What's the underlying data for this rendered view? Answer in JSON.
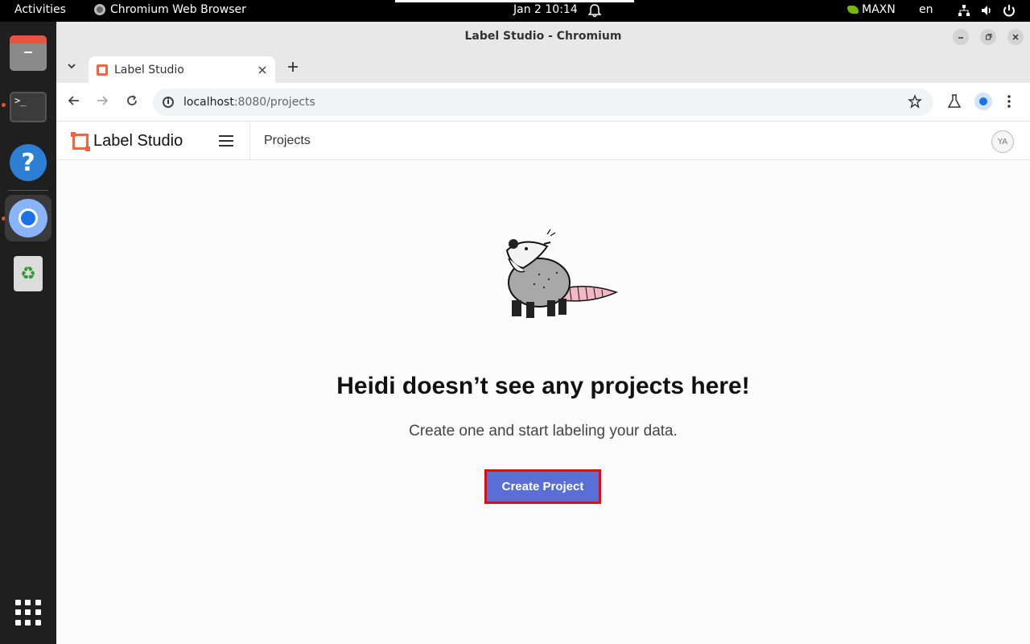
{
  "system": {
    "activities": "Activities",
    "app_name": "Chromium Web Browser",
    "clock": "Jan 2  10:14",
    "power_mode": "MAXN",
    "language": "en"
  },
  "browser": {
    "window_title": "Label Studio - Chromium",
    "tab_title": "Label Studio",
    "url_host": "localhost",
    "url_rest": ":8080/projects"
  },
  "app": {
    "logo_text": "Label Studio",
    "header_title": "Projects",
    "user_initials": "YA",
    "empty_title": "Heidi doesn’t see any projects here!",
    "empty_subtitle": "Create one and start labeling your data.",
    "create_button": "Create Project"
  },
  "colors": {
    "accent": "#5a6fd6",
    "brand": "#f4643f",
    "highlight": "#ff0000"
  }
}
